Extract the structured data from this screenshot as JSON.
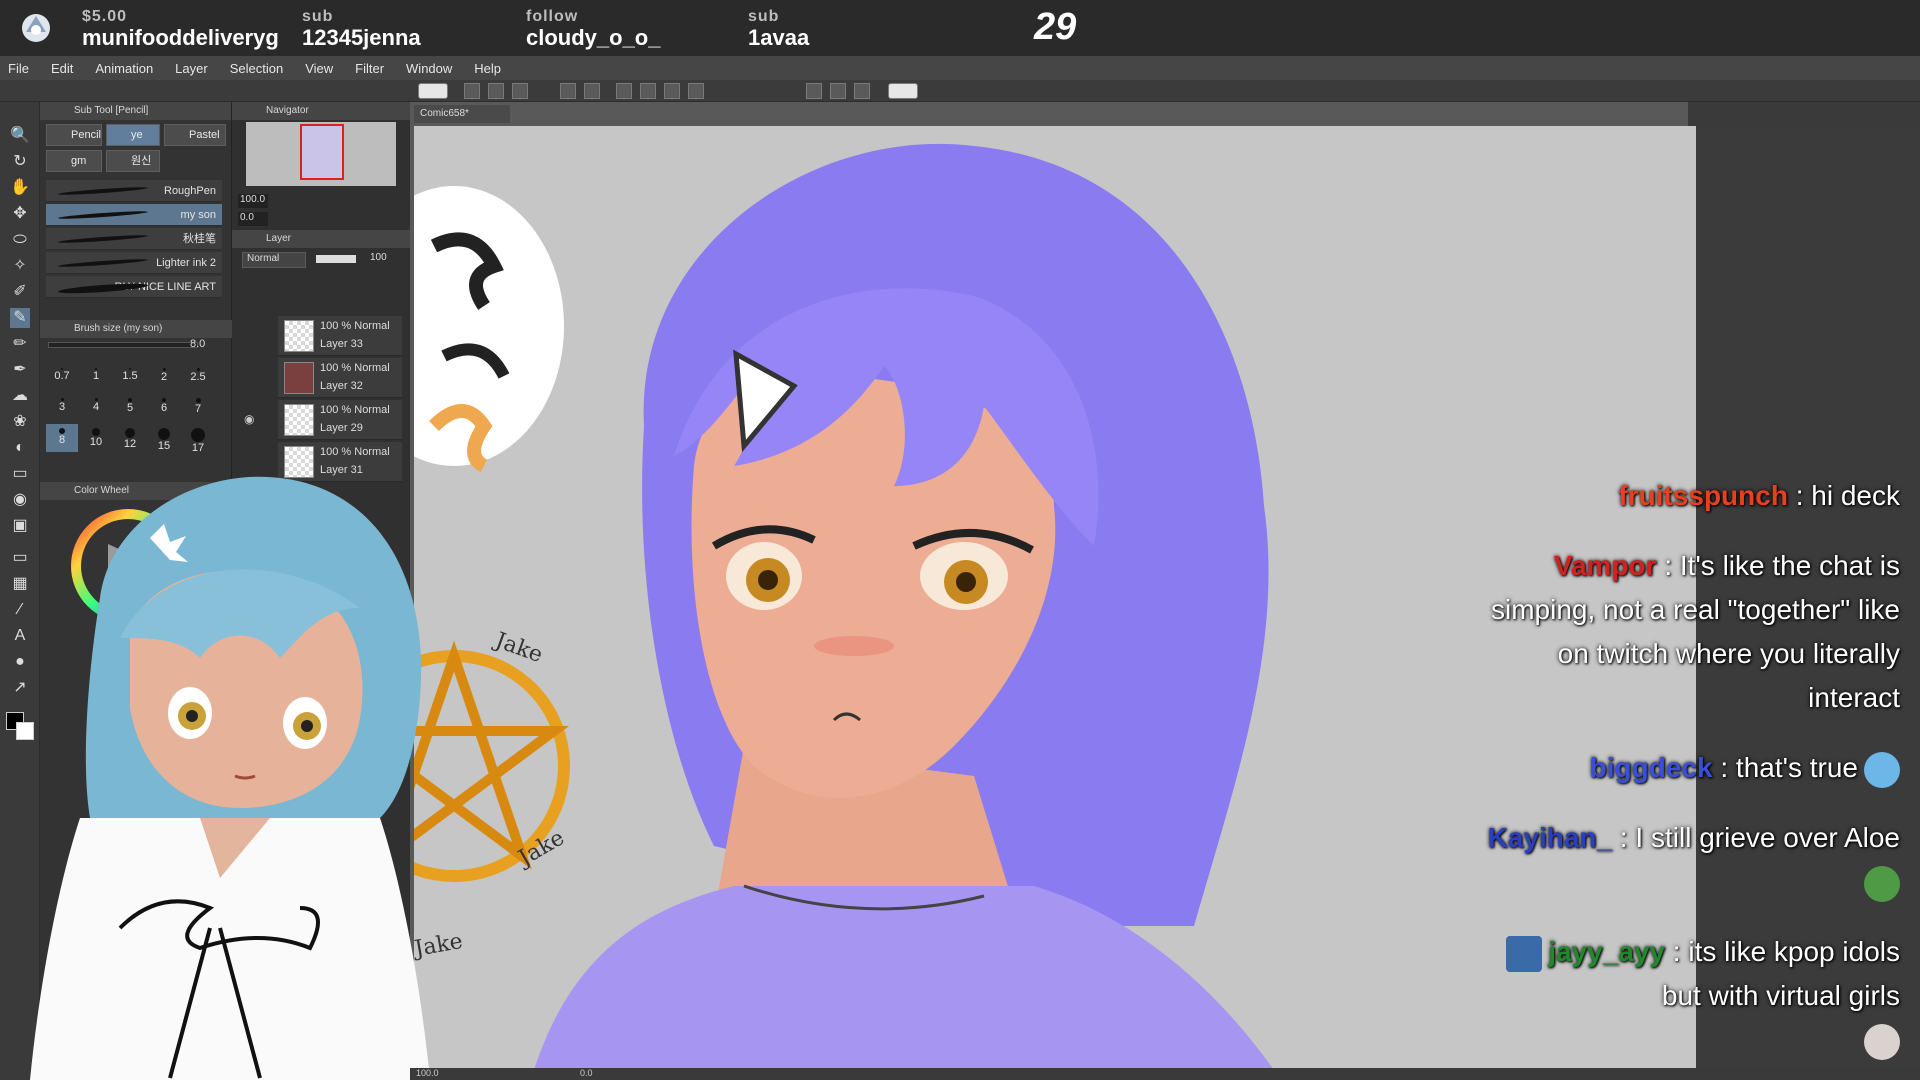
{
  "alerts": [
    {
      "kind": "$5.00",
      "name": "munifooddeliveryg"
    },
    {
      "kind": "sub",
      "name": "12345jenna"
    },
    {
      "kind": "follow",
      "name": "cloudy_o_o_"
    },
    {
      "kind": "sub",
      "name": "1avaa"
    }
  ],
  "counter": "29",
  "menu": [
    "File",
    "Edit",
    "Animation",
    "Layer",
    "Selection",
    "View",
    "Filter",
    "Window",
    "Help"
  ],
  "subtool": {
    "header": "Sub Tool [Pencil]",
    "tabs": [
      "Pencil",
      "ye",
      "Pastel",
      "gm",
      "원신"
    ],
    "brushes": [
      "RoughPen",
      "my son",
      "秋桂笔",
      "Lighter ink 2",
      "RLY NICE LINE ART"
    ],
    "brush_size_header": "Brush size (my son)",
    "brush_size_value": "8.0",
    "sizes": [
      "0.7",
      "1",
      "1.5",
      "2",
      "2.5",
      "3",
      "4",
      "5",
      "6",
      "7",
      "8",
      "10",
      "12",
      "15",
      "17"
    ],
    "color_wheel_header": "Color Wheel"
  },
  "navigator": {
    "header": "Navigator",
    "zoom": "100.0",
    "rotation": "0.0",
    "layer_header": "Layer",
    "blend_mode": "Normal",
    "opacity": "100",
    "layers": [
      {
        "info": "100 % Normal",
        "name": "Layer 33"
      },
      {
        "info": "100 % Normal",
        "name": "Layer 32"
      },
      {
        "info": "100 % Normal",
        "name": "Layer 29"
      },
      {
        "info": "100 % Normal",
        "name": "Layer 31"
      }
    ]
  },
  "document_tab": "Comic658*",
  "status": {
    "zoom": "100.0",
    "rotation": "0.0"
  },
  "chat": [
    {
      "user": "fruitsspunch",
      "user_color": "#e8401c",
      "text": "hi deck",
      "emote": false
    },
    {
      "user": "Vampor",
      "user_color": "#d62020",
      "text": "It's like the chat is simping, not a real \"together\" like on twitch where you literally interact",
      "emote": false
    },
    {
      "user": "biggdeck",
      "user_color": "#3a4fd8",
      "text": "that's true",
      "emote": true
    },
    {
      "user": "Kayihan_",
      "user_color": "#2a3fc0",
      "text": "I still grieve over Aloe",
      "emote": true
    },
    {
      "user": "jayy_ayy",
      "user_color": "#1f8a2a",
      "text": "its like kpop idols but with virtual girls",
      "emote": true
    }
  ],
  "canvas_sign": [
    "Jake",
    "Jake",
    "Jake"
  ]
}
